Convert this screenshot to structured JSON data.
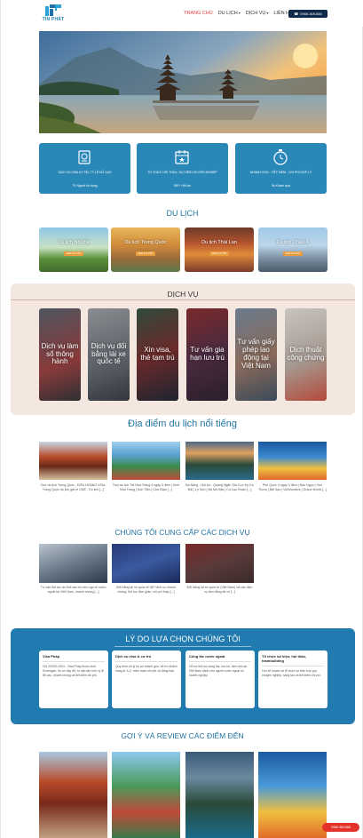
{
  "brand": {
    "name": "TÍN PHÁT"
  },
  "nav": {
    "items": [
      {
        "label": "TRANG CHỦ",
        "active": true
      },
      {
        "label": "DU LỊCH",
        "caret": true
      },
      {
        "label": "DỊCH VỤ",
        "caret": true
      },
      {
        "label": "LIÊN HỆ",
        "caret": false
      }
    ],
    "phone": "0966.369.666"
  },
  "stats": [
    {
      "icon": "passport-icon",
      "label": "DỊCH VỤ VISA UY TÍN, TỶ LỆ ĐỖ CAO",
      "value": "7K Người sử dụng"
    },
    {
      "icon": "calendar-icon",
      "label": "TỔ CHỨC HỘI THẢO, SỰ KIỆN CHUYÊN NGHIỆP",
      "value": "300+ Hội lớn"
    },
    {
      "icon": "stopwatch-icon",
      "label": "NHANH GỌN - TIẾT KIỆM - CHI PHÍ HỢP LÝ",
      "value": "5k Khách quà"
    }
  ],
  "sections": {
    "travel": "DU LỊCH",
    "services": "DỊCH VỤ",
    "places": "Địa điểm du lịch nổi tiếng",
    "provided": "CHÚNG TÔI CUNG CẤP CÁC DỊCH VỤ",
    "reasons": "LÝ DO LỰA CHỌN CHÚNG TÔI",
    "reviews": "GỢI Ý VÀ REVIEW CÁC ĐIỂM ĐẾN"
  },
  "travel": [
    {
      "label": "Du lịch Nội địa",
      "button": "XEM CHI TIẾT"
    },
    {
      "label": "Du lịch Trung Quốc",
      "button": "XEM CHI TIẾT"
    },
    {
      "label": "Du lịch Thái Lan",
      "button": "XEM CHI TIẾT"
    },
    {
      "label": "Du lịch Châu Á",
      "button": "XEM CHI TIẾT"
    }
  ],
  "services": [
    "Dịch vụ làm sổ thông hành",
    "Dịch vụ đổi bằng lái xe quốc tế",
    "Xin visa, thẻ tạm trú",
    "Tư vấn gia hạn lưu trú",
    "Tư vấn giấy phép lao động tại Việt Nam",
    "Dịch thuật công chứng"
  ],
  "places": [
    "Tour du lịch Trung Quốc - ĐÔN HOÀNG VISA, Trung Quốc du lịch giá rẻ ONE - Du lịch [...]",
    "Tour du lịch Tết Nha Trang 4 ngày 3 đêm | Vịnh Nha Trang | Hòn Tằm | Chợ Đầm [...]",
    "Đà Nẵng - Hội An - Quảng Ngãi: Giá Cực Kỳ Ưu Đãi | Lý Sơn | Bà Nà Hills | Cù Lao Chàm [...]",
    "Phú Quốc 4 ngày 3 đêm | Đảo Ngọc | Hòn Thơm | Bãi Sao | VinWonders | Grand World [...]"
  ],
  "provided": [
    "Tư vấn thủ tục xin thẻ tạm trú cho người nước ngoài tại Việt Nam, nhanh chóng [...]",
    "Đổi bằng lái xe quốc tế IDP dịch vụ nhanh chóng, thủ tục đơn giản, chi phí thấp [...]",
    "Đổi bằng lái xe quốc tế (Việt Nam) và các dịch vụ làm bằng lái xe [...]"
  ],
  "reasons": [
    {
      "title": "Visa Pháp",
      "body": "Chi 2/2023-2024 - Visa Pháp thuộc khối Schengen, hồ sơ đầy đủ, tư vấn tận tình, tỷ lệ đỗ cao, nhanh chóng và tiết kiệm chi phí."
    },
    {
      "title": "Dịch vụ visa & cư trú",
      "body": "Quy trình xử lý hồ sơ nhanh gọn, hỗ trợ khách hàng từ A-Z, minh bạch chi phí và đúng hạn."
    },
    {
      "title": "Công tác nước ngoài",
      "body": "Hỗ trợ thủ tục công tác, lưu trú, làm việc tại Việt Nam dành cho người nước ngoài và doanh nghiệp."
    },
    {
      "title": "Tổ chức sự kiện, hội thảo, teambuilding",
      "body": "Lên kế hoạch và tổ chức sự kiện trọn gói, chuyên nghiệp, sáng tạo và tiết kiệm chi phí."
    }
  ],
  "float_button": "0966.369.666"
}
